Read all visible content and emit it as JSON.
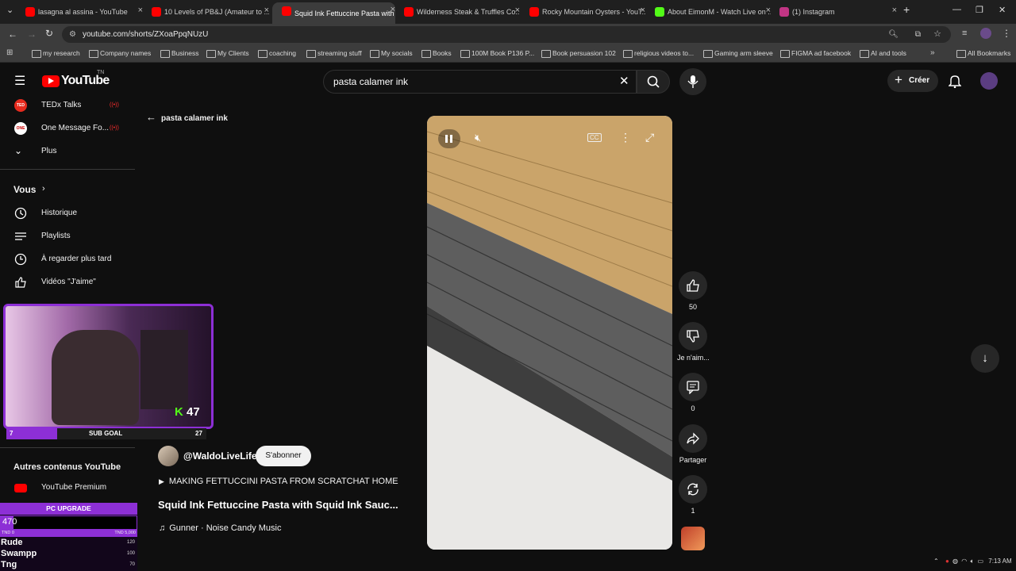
{
  "browser": {
    "tabs": [
      {
        "title": "lasagna al assina - YouTube",
        "fav": "#ff0000"
      },
      {
        "title": "10 Levels of PB&J (Amateur to ...",
        "fav": "#ff0000"
      },
      {
        "title": "Squid Ink Fettuccine Pasta with ...",
        "fav": "#ff0000",
        "active": true
      },
      {
        "title": "Wilderness Steak & Truffles Co...",
        "fav": "#ff0000"
      },
      {
        "title": "Rocky Mountain Oysters - YouT...",
        "fav": "#ff0000"
      },
      {
        "title": "About EimonM - Watch Live on ...",
        "fav": "#53fc18"
      },
      {
        "title": "(1) Instagram",
        "fav": "#c13584"
      }
    ],
    "url": "youtube.com/shorts/ZXoaPpqNUzU",
    "bookmarks": [
      "my research",
      "Company names",
      "Business",
      "My Clients",
      "coaching",
      "streaming stuff",
      "My socials",
      "Books",
      "100M Book P136 P...",
      "Book persuasion 102",
      "religious videos to...",
      "Gaming arm sleeve",
      "FIGMA ad facebook",
      "AI and tools"
    ],
    "all_bookmarks": "All Bookmarks"
  },
  "youtube": {
    "logo_text": "YouTube",
    "logo_region": "TN",
    "search_value": "pasta calamer ink",
    "create_label": "Créer",
    "back_label": "pasta calamer ink",
    "sidebar": {
      "subs": [
        {
          "label": "TEDx Talks"
        },
        {
          "label": "One Message Fo..."
        }
      ],
      "more": "Plus",
      "you_header": "Vous",
      "you_items": [
        {
          "label": "Historique"
        },
        {
          "label": "Playlists"
        },
        {
          "label": "À regarder plus tard"
        },
        {
          "label": "Vidéos \"J'aime\""
        }
      ],
      "other_header": "Autres contenus YouTube",
      "premium": "YouTube Premium"
    },
    "short": {
      "channel": "@WaldoLiveLife",
      "subscribe": "S'abonner",
      "caption": "MAKING FETTUCCINI PASTA FROM SCRATCHAT HOME",
      "title": "Squid Ink Fettuccine Pasta with Squid Ink Sauc...",
      "music": "Gunner · Noise Candy Music",
      "like_count": "50",
      "dislike_label": "Je n'aim...",
      "comment_count": "0",
      "share_label": "Partager",
      "remix_count": "1"
    }
  },
  "overlay": {
    "cam_count": "47",
    "subgoal_label": "SUB GOAL",
    "subgoal_left": "7",
    "subgoal_right": "27",
    "pc_upgrade": "PC UPGRADE",
    "pc_value": "470",
    "pc_min": "TND 0",
    "pc_max": "TND 5,000",
    "leaders": [
      {
        "name": "Rude",
        "val": "120"
      },
      {
        "name": "Swampp",
        "val": "100"
      },
      {
        "name": "Tng",
        "val": "70"
      }
    ]
  },
  "taskbar": {
    "time": "7:13 AM"
  }
}
